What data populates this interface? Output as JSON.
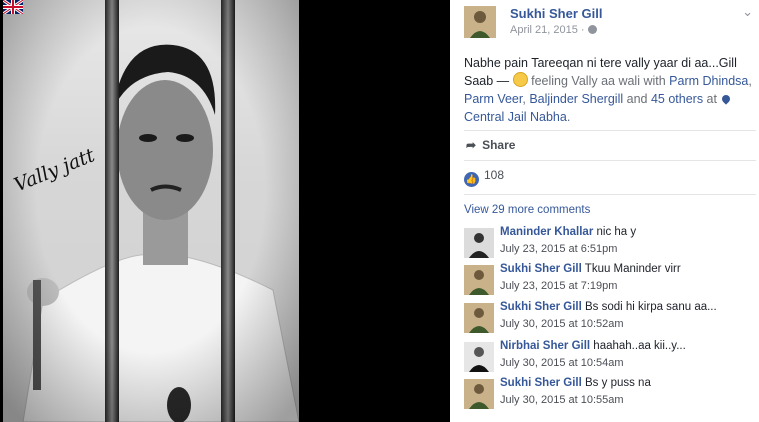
{
  "photo": {
    "caption": "Vally jatt",
    "flag_icon": "uk-flag-icon"
  },
  "post": {
    "author": "Sukhi Sher Gill",
    "date": "April 21, 2015 ·",
    "text_main": "Nabhe pain Tareeqan ni tere vally yaar di aa...Gill Saab — ",
    "feeling": "feeling Vally aa wali with ",
    "tag1": "Parm Dhindsa",
    "comma1": ", ",
    "tag2": "Parm Veer",
    "comma2": ", ",
    "tag3": "Baljinder Shergill",
    "and": " and ",
    "tag4": "45 others",
    "at": " at ",
    "place": "Central Jail Nabha",
    "period": ".",
    "share_label": "Share",
    "like_count": "108",
    "view_more": "View 29 more comments"
  },
  "comments": [
    {
      "name": "Maninder Khallar",
      "text": " nic ha y",
      "date": "July 23, 2015 at 6:51pm"
    },
    {
      "name": "Sukhi Sher Gill",
      "text": " Tkuu Maninder virr",
      "date": "July 23, 2015 at 7:19pm"
    },
    {
      "name": "Sukhi Sher Gill",
      "text": " Bs sodi hi kirpa sanu aa...",
      "date": "July 30, 2015 at 10:52am"
    },
    {
      "name": "Nirbhai Sher Gill",
      "text": " haahah..aa kii..y...",
      "date": "July 30, 2015 at 10:54am"
    },
    {
      "name": "Sukhi Sher Gill",
      "text": " Bs y puss na",
      "date": "July 30, 2015 at 10:55am"
    }
  ],
  "colors": {
    "link": "#365899",
    "like_badge": "#4267b2"
  }
}
